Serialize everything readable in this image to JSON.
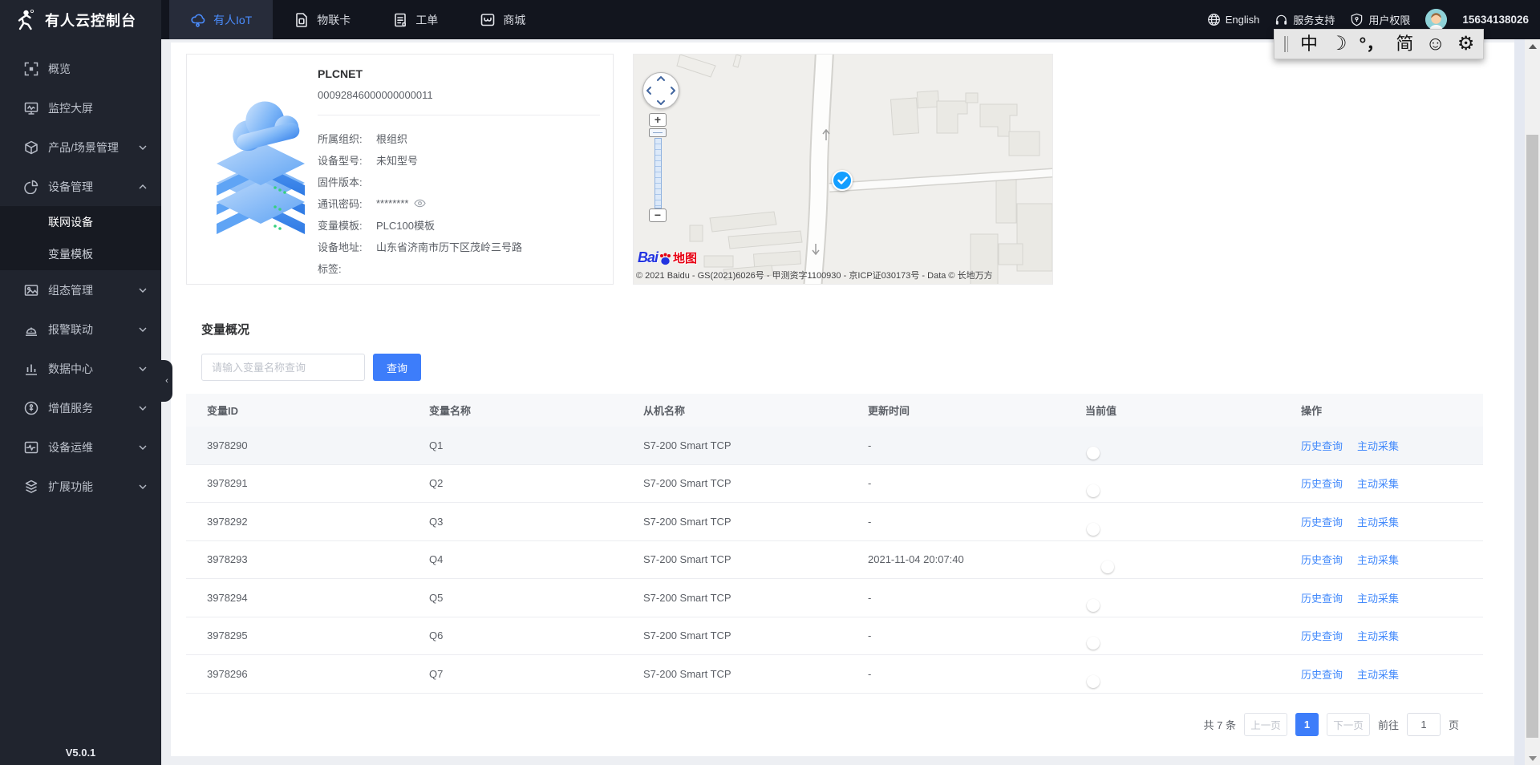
{
  "navbar": {
    "logo_title": "有人云控制台",
    "tabs": [
      {
        "label": "有人IoT"
      },
      {
        "label": "物联卡"
      },
      {
        "label": "工单"
      },
      {
        "label": "商城"
      }
    ],
    "right": {
      "language": "English",
      "support": "服务支持",
      "permission": "用户权限",
      "phone": "15634138026"
    }
  },
  "ime": {
    "mode": "中",
    "moon": "☽",
    "punct": "°，",
    "simplified": "简",
    "smiley": "☺",
    "gear": "⚙"
  },
  "sidebar": {
    "items": [
      {
        "label": "概览"
      },
      {
        "label": "监控大屏"
      },
      {
        "label": "产品/场景管理"
      },
      {
        "label": "设备管理",
        "children": [
          "联网设备",
          "变量模板"
        ]
      },
      {
        "label": "组态管理"
      },
      {
        "label": "报警联动"
      },
      {
        "label": "数据中心"
      },
      {
        "label": "增值服务"
      },
      {
        "label": "设备运维"
      },
      {
        "label": "扩展功能"
      }
    ],
    "version": "V5.0.1"
  },
  "device": {
    "name": "PLCNET",
    "id": "00092846000000000011",
    "fields": [
      {
        "label": "所属组织:",
        "value": "根组织"
      },
      {
        "label": "设备型号:",
        "value": "未知型号"
      },
      {
        "label": "固件版本:",
        "value": ""
      },
      {
        "label": "通讯密码:",
        "value": "********"
      },
      {
        "label": "变量模板:",
        "value": "PLC100模板"
      },
      {
        "label": "设备地址:",
        "value": "山东省济南市历下区茂岭三号路"
      },
      {
        "label": "标签:",
        "value": ""
      }
    ]
  },
  "map": {
    "logo_bai": "Bai",
    "logo_ditu": "地图",
    "copyright": "© 2021 Baidu - GS(2021)6026号 - 甲测资字1100930 - 京ICP证030173号 - Data © 长地万方"
  },
  "variables": {
    "title": "变量概况",
    "search_placeholder": "请输入变量名称查询",
    "search_button": "查询",
    "table": {
      "headers": [
        "变量ID",
        "变量名称",
        "从机名称",
        "更新时间",
        "当前值",
        "操作"
      ],
      "rows": [
        {
          "id": "3978290",
          "name": "Q1",
          "slave": "S7-200 Smart TCP",
          "updated": "-",
          "on": false
        },
        {
          "id": "3978291",
          "name": "Q2",
          "slave": "S7-200 Smart TCP",
          "updated": "-",
          "on": false
        },
        {
          "id": "3978292",
          "name": "Q3",
          "slave": "S7-200 Smart TCP",
          "updated": "-",
          "on": false
        },
        {
          "id": "3978293",
          "name": "Q4",
          "slave": "S7-200 Smart TCP",
          "updated": "2021-11-04 20:07:40",
          "on": true
        },
        {
          "id": "3978294",
          "name": "Q5",
          "slave": "S7-200 Smart TCP",
          "updated": "-",
          "on": false
        },
        {
          "id": "3978295",
          "name": "Q6",
          "slave": "S7-200 Smart TCP",
          "updated": "-",
          "on": false
        },
        {
          "id": "3978296",
          "name": "Q7",
          "slave": "S7-200 Smart TCP",
          "updated": "-",
          "on": false
        }
      ],
      "actions": [
        "历史查询",
        "主动采集"
      ]
    },
    "pagination": {
      "total": "共 7 条",
      "prev": "上一页",
      "current": "1",
      "next": "下一页",
      "goto_label": "前往",
      "goto_value": "1",
      "page_label": "页"
    }
  },
  "colors": {
    "accent": "#3d7dfa",
    "link": "#4289fb",
    "toggle_on": "#3fa0ff",
    "tab_active_text": "#4a8dff"
  }
}
